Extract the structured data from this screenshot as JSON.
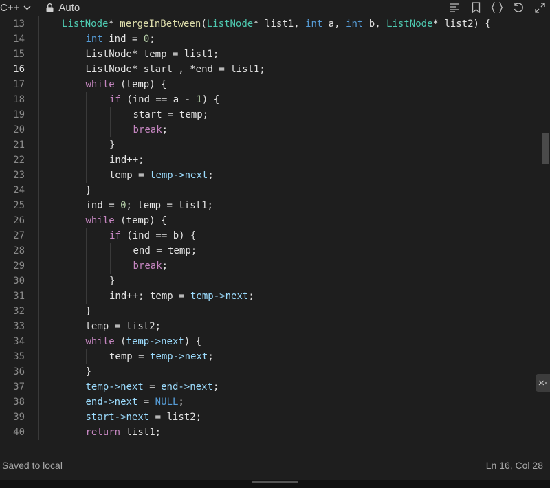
{
  "toolbar": {
    "language": "C++",
    "mode": "Auto",
    "icons": [
      "chevron-down-icon",
      "lock-icon",
      "format-icon",
      "bookmark-icon",
      "braces-icon",
      "reset-icon",
      "expand-icon"
    ]
  },
  "editor": {
    "current_line": "16",
    "lines": [
      {
        "n": "13",
        "indent": 1,
        "segs": [
          [
            "t",
            "ListNode"
          ],
          [
            "",
            "* "
          ],
          [
            "f",
            "mergeInBetween"
          ],
          [
            "",
            "("
          ],
          [
            "t",
            "ListNode"
          ],
          [
            "",
            "* list1, "
          ],
          [
            "p",
            "int"
          ],
          [
            "",
            " a, "
          ],
          [
            "p",
            "int"
          ],
          [
            "",
            " b, "
          ],
          [
            "t",
            "ListNode"
          ],
          [
            "",
            "* list2) {"
          ]
        ]
      },
      {
        "n": "14",
        "indent": 2,
        "segs": [
          [
            "p",
            "int"
          ],
          [
            "",
            " ind = "
          ],
          [
            "n",
            "0"
          ],
          [
            "",
            ";"
          ]
        ]
      },
      {
        "n": "15",
        "indent": 2,
        "segs": [
          [
            "",
            "ListNode* temp = list1;"
          ]
        ]
      },
      {
        "n": "16",
        "indent": 2,
        "segs": [
          [
            "",
            "ListNode* start , *end = list1;"
          ]
        ]
      },
      {
        "n": "17",
        "indent": 2,
        "segs": [
          [
            "k",
            "while"
          ],
          [
            "",
            " (temp) {"
          ]
        ]
      },
      {
        "n": "18",
        "indent": 3,
        "segs": [
          [
            "k",
            "if"
          ],
          [
            "",
            " (ind == a - "
          ],
          [
            "n",
            "1"
          ],
          [
            "",
            ") {"
          ]
        ]
      },
      {
        "n": "19",
        "indent": 4,
        "segs": [
          [
            "",
            "start = temp;"
          ]
        ]
      },
      {
        "n": "20",
        "indent": 4,
        "segs": [
          [
            "k",
            "break"
          ],
          [
            "",
            ";"
          ]
        ]
      },
      {
        "n": "21",
        "indent": 3,
        "segs": [
          [
            "",
            "}"
          ]
        ]
      },
      {
        "n": "22",
        "indent": 3,
        "segs": [
          [
            "",
            "ind++;"
          ]
        ]
      },
      {
        "n": "23",
        "indent": 3,
        "segs": [
          [
            "",
            "temp = "
          ],
          [
            "v",
            "temp->next"
          ],
          [
            "",
            ";"
          ]
        ]
      },
      {
        "n": "24",
        "indent": 2,
        "segs": [
          [
            "",
            "}"
          ]
        ]
      },
      {
        "n": "25",
        "indent": 2,
        "segs": [
          [
            "",
            "ind = "
          ],
          [
            "n",
            "0"
          ],
          [
            "",
            "; temp = list1;"
          ]
        ]
      },
      {
        "n": "26",
        "indent": 2,
        "segs": [
          [
            "k",
            "while"
          ],
          [
            "",
            " (temp) {"
          ]
        ]
      },
      {
        "n": "27",
        "indent": 3,
        "segs": [
          [
            "k",
            "if"
          ],
          [
            "",
            " (ind == b) {"
          ]
        ]
      },
      {
        "n": "28",
        "indent": 4,
        "segs": [
          [
            "",
            "end = temp;"
          ]
        ]
      },
      {
        "n": "29",
        "indent": 4,
        "segs": [
          [
            "k",
            "break"
          ],
          [
            "",
            ";"
          ]
        ]
      },
      {
        "n": "30",
        "indent": 3,
        "segs": [
          [
            "",
            "}"
          ]
        ]
      },
      {
        "n": "31",
        "indent": 3,
        "segs": [
          [
            "",
            "ind++; temp = "
          ],
          [
            "v",
            "temp->next"
          ],
          [
            "",
            ";"
          ]
        ]
      },
      {
        "n": "32",
        "indent": 2,
        "segs": [
          [
            "",
            "}"
          ]
        ]
      },
      {
        "n": "33",
        "indent": 2,
        "segs": [
          [
            "",
            "temp = list2;"
          ]
        ]
      },
      {
        "n": "34",
        "indent": 2,
        "segs": [
          [
            "k",
            "while"
          ],
          [
            "",
            " ("
          ],
          [
            "v",
            "temp->next"
          ],
          [
            "",
            ") {"
          ]
        ]
      },
      {
        "n": "35",
        "indent": 3,
        "segs": [
          [
            "",
            "temp = "
          ],
          [
            "v",
            "temp->next"
          ],
          [
            "",
            ";"
          ]
        ]
      },
      {
        "n": "36",
        "indent": 2,
        "segs": [
          [
            "",
            "}"
          ]
        ]
      },
      {
        "n": "37",
        "indent": 2,
        "segs": [
          [
            "v",
            "temp->next"
          ],
          [
            "",
            " = "
          ],
          [
            "v",
            "end->next"
          ],
          [
            "",
            ";"
          ]
        ]
      },
      {
        "n": "38",
        "indent": 2,
        "segs": [
          [
            "v",
            "end->next"
          ],
          [
            "",
            " = "
          ],
          [
            "c",
            "NULL"
          ],
          [
            "",
            ";"
          ]
        ]
      },
      {
        "n": "39",
        "indent": 2,
        "segs": [
          [
            "v",
            "start->next"
          ],
          [
            "",
            " = list2;"
          ]
        ]
      },
      {
        "n": "40",
        "indent": 2,
        "segs": [
          [
            "k",
            "return"
          ],
          [
            "",
            " list1;"
          ]
        ]
      }
    ]
  },
  "status": {
    "saved": "Saved to local",
    "position": "Ln 16, Col 28"
  }
}
